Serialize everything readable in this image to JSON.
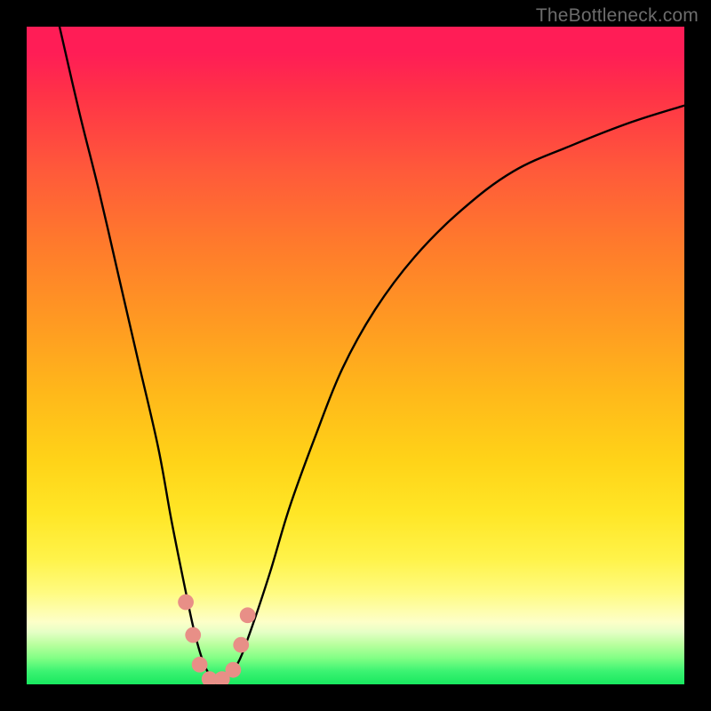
{
  "watermark": "TheBottleneck.com",
  "chart_data": {
    "type": "line",
    "title": "",
    "xlabel": "",
    "ylabel": "",
    "xlim": [
      0,
      100
    ],
    "ylim": [
      0,
      100
    ],
    "grid": false,
    "legend": false,
    "background": {
      "style": "vertical-gradient",
      "stops": [
        {
          "pct": 0,
          "color": "#ff1d56"
        },
        {
          "pct": 50,
          "color": "#ffae1e"
        },
        {
          "pct": 85,
          "color": "#fffb80"
        },
        {
          "pct": 100,
          "color": "#18e85f"
        }
      ]
    },
    "series": [
      {
        "name": "bottleneck-curve",
        "stroke": "#000000",
        "x": [
          5,
          8,
          11,
          14,
          17,
          20,
          22,
          24,
          25.5,
          27,
          28.5,
          30,
          32,
          34,
          37,
          40,
          44,
          48,
          53,
          59,
          66,
          74,
          83,
          92,
          100
        ],
        "y": [
          100,
          87,
          75,
          62,
          49,
          36,
          25,
          15,
          8,
          3,
          0.7,
          0.7,
          3,
          8,
          17,
          27,
          38,
          48,
          57,
          65,
          72,
          78,
          82,
          85.5,
          88
        ]
      }
    ],
    "markers": [
      {
        "name": "trough-dots",
        "shape": "circle",
        "fill": "#e88f87",
        "r_pct": 1.2,
        "points": [
          {
            "x": 24.2,
            "y": 12.5
          },
          {
            "x": 25.3,
            "y": 7.5
          },
          {
            "x": 26.3,
            "y": 3.0
          },
          {
            "x": 27.8,
            "y": 0.8
          },
          {
            "x": 29.7,
            "y": 0.8
          },
          {
            "x": 31.4,
            "y": 2.2
          },
          {
            "x": 32.6,
            "y": 6.0
          },
          {
            "x": 33.6,
            "y": 10.5
          }
        ]
      }
    ],
    "curve_minimum_x_pct": 29
  }
}
